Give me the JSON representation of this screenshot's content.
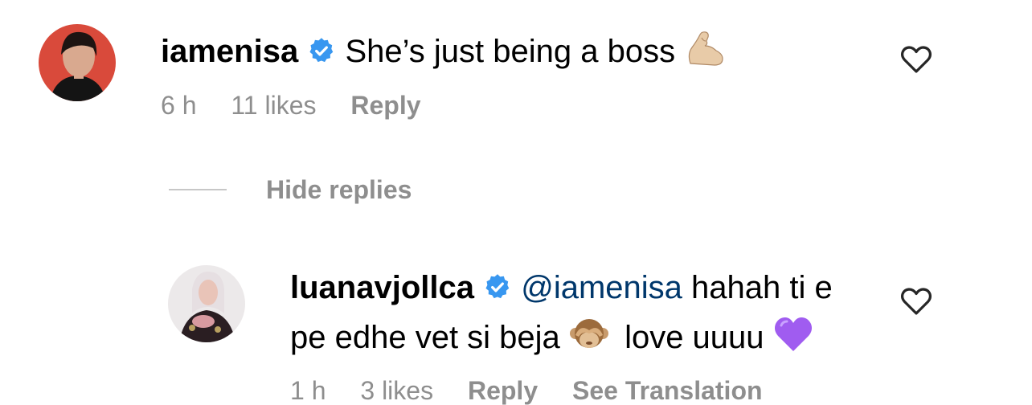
{
  "comments": [
    {
      "username": "iamenisa",
      "text": "She’s just being a boss",
      "emoji": "flexed-biceps",
      "time": "6 h",
      "likes": "11 likes",
      "reply_label": "Reply"
    }
  ],
  "replies_toggle": {
    "label": "Hide replies"
  },
  "replies": [
    {
      "username": "luanavjollca",
      "mention": "@iamenisa",
      "text_line1": "hahah ti e",
      "text_line2_a": "pe edhe vet si beja",
      "emoji_1": "see-no-evil-monkey",
      "text_line2_b": "love uuuu",
      "emoji_2": "purple-heart",
      "time": "1 h",
      "likes": "3 likes",
      "reply_label": "Reply",
      "translation_label": "See Translation"
    }
  ],
  "colors": {
    "meta_gray": "#8e8e8e",
    "mention_blue": "#00376b",
    "verified_blue": "#3897f0",
    "purple_heart": "#a05cf0"
  }
}
